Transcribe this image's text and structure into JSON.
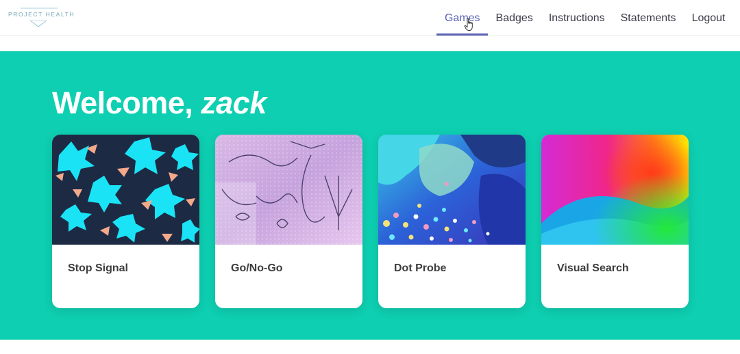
{
  "header": {
    "logo_text": "PROJECT HEALTH",
    "nav": [
      {
        "label": "Games",
        "active": true
      },
      {
        "label": "Badges",
        "active": false
      },
      {
        "label": "Instructions",
        "active": false
      },
      {
        "label": "Statements",
        "active": false
      },
      {
        "label": "Logout",
        "active": false
      }
    ]
  },
  "hero": {
    "greeting": "Welcome,",
    "username": "zack"
  },
  "games": [
    {
      "title": "Stop Signal"
    },
    {
      "title": "Go/No-Go"
    },
    {
      "title": "Dot Probe"
    },
    {
      "title": "Visual Search"
    }
  ],
  "colors": {
    "hero_bg": "#0ecfb1",
    "nav_active": "#5a63b3",
    "nav_text": "#3b3b4a"
  }
}
